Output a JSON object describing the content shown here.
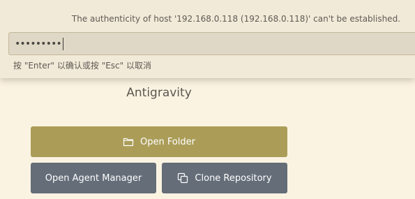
{
  "quick_input": {
    "message": "The authenticity of host '192.168.0.118 (192.168.0.118)' can't be established.",
    "input_value": "•••••••••",
    "hint": "按 \"Enter\" 以确认或按 \"Esc\" 以取消"
  },
  "welcome": {
    "title": "Antigravity",
    "open_folder_label": "Open Folder",
    "open_folder_icon": "folder-icon",
    "agent_manager_label": "Open Agent Manager",
    "clone_repo_label": "Clone Repository",
    "clone_repo_icon": "copy-icon"
  },
  "colors": {
    "background": "#fbf3e2",
    "primary_button": "#ab9d58",
    "secondary_button": "#646d78"
  }
}
